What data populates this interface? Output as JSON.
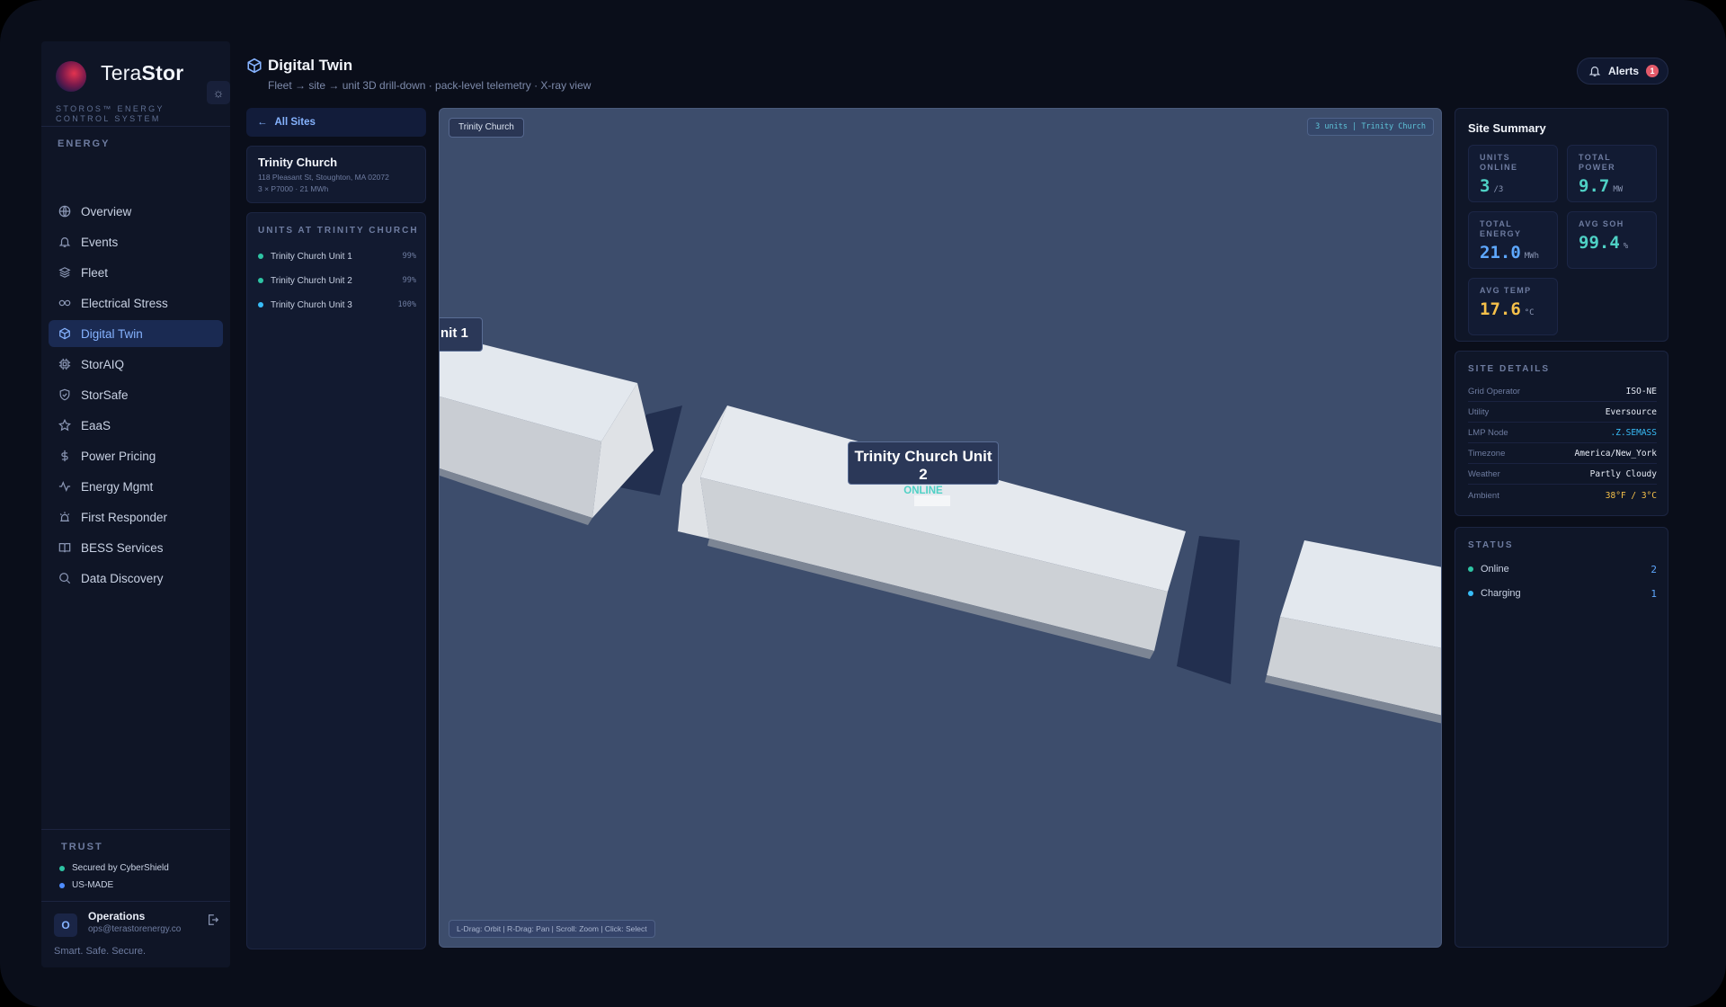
{
  "brand": {
    "name_light": "Tera",
    "name_bold": "Stor",
    "subtitle": "STOROS™ ENERGY CONTROL SYSTEM"
  },
  "sidebar": {
    "section": "ENERGY",
    "items": [
      {
        "label": "Overview",
        "icon": "globe-icon"
      },
      {
        "label": "Events",
        "icon": "bell-icon"
      },
      {
        "label": "Fleet",
        "icon": "layers-icon"
      },
      {
        "label": "Electrical Stress",
        "icon": "link-icon"
      },
      {
        "label": "Digital Twin",
        "icon": "cube-icon",
        "active": true
      },
      {
        "label": "StorAIQ",
        "icon": "chip-icon"
      },
      {
        "label": "StorSafe",
        "icon": "shield-icon"
      },
      {
        "label": "EaaS",
        "icon": "star-icon"
      },
      {
        "label": "Power Pricing",
        "icon": "dollar-icon"
      },
      {
        "label": "Energy Mgmt",
        "icon": "pulse-icon"
      },
      {
        "label": "First Responder",
        "icon": "siren-icon"
      },
      {
        "label": "BESS Services",
        "icon": "book-icon"
      },
      {
        "label": "Data Discovery",
        "icon": "search-icon"
      }
    ],
    "trust_label": "TRUST",
    "trust_items": [
      {
        "label": "Secured by CyberShield",
        "color": "#2ec4a4"
      },
      {
        "label": "US-MADE",
        "color": "#4f8dff"
      }
    ],
    "user": {
      "initial": "O",
      "name": "Operations",
      "email": "ops@terastorenergy.co"
    },
    "tagline": "Smart. Safe. Secure."
  },
  "header": {
    "title": "Digital Twin",
    "subtitle": "Fleet → site → unit 3D drill-down · pack-level telemetry · X-ray view",
    "alerts_label": "Alerts",
    "alerts_count": "1"
  },
  "sites": {
    "back_label": "All Sites",
    "site": {
      "name": "Trinity Church",
      "address": "118 Pleasant St, Stoughton, MA 02072",
      "meta": "3 × P7000 · 21 MWh"
    },
    "units_label": "UNITS AT TRINITY CHURCH",
    "units": [
      {
        "name": "Trinity Church Unit 1",
        "pct": "99%",
        "color": "#2ec4a4"
      },
      {
        "name": "Trinity Church Unit 2",
        "pct": "99%",
        "color": "#2ec4a4"
      },
      {
        "name": "Trinity Church Unit 3",
        "pct": "100%",
        "color": "#38bdf8"
      }
    ]
  },
  "viewport": {
    "site_chip": "Trinity Church",
    "info": "3 units | Trinity Church",
    "hint": "L-Drag: Orbit | R-Drag: Pan | Scroll: Zoom | Click: Select",
    "unit1_label": "nit 1",
    "unit2_label": "Trinity Church Unit 2",
    "unit2_status": "ONLINE"
  },
  "summary": {
    "title": "Site Summary",
    "stats": [
      {
        "label": "UNITS ONLINE",
        "value": "3",
        "unit": "/3",
        "color": "#4fd1c5"
      },
      {
        "label": "TOTAL POWER",
        "value": "9.7",
        "unit": "MW",
        "color": "#4fd1c5"
      },
      {
        "label": "TOTAL ENERGY",
        "value": "21.0",
        "unit": "MWh",
        "color": "#5ea8ff"
      },
      {
        "label": "AVG SOH",
        "value": "99.4",
        "unit": "%",
        "color": "#4fd1c5"
      },
      {
        "label": "AVG TEMP",
        "value": "17.6",
        "unit": "°C",
        "color": "#f5c04a"
      }
    ]
  },
  "details": {
    "label": "SITE DETAILS",
    "rows": [
      {
        "k": "Grid Operator",
        "v": "ISO-NE",
        "color": "#e8edf7"
      },
      {
        "k": "Utility",
        "v": "Eversource",
        "color": "#e8edf7"
      },
      {
        "k": "LMP Node",
        "v": ".Z.SEMASS",
        "color": "#38bdf8"
      },
      {
        "k": "Timezone",
        "v": "America/New_York",
        "color": "#e8edf7"
      },
      {
        "k": "Weather",
        "v": "Partly Cloudy",
        "color": "#e8edf7"
      },
      {
        "k": "Ambient",
        "v": "38°F / 3°C",
        "color": "#f5c04a"
      }
    ]
  },
  "status": {
    "label": "STATUS",
    "rows": [
      {
        "label": "Online",
        "count": "2",
        "color": "#2ec4a4"
      },
      {
        "label": "Charging",
        "count": "1",
        "color": "#38bdf8"
      }
    ]
  }
}
